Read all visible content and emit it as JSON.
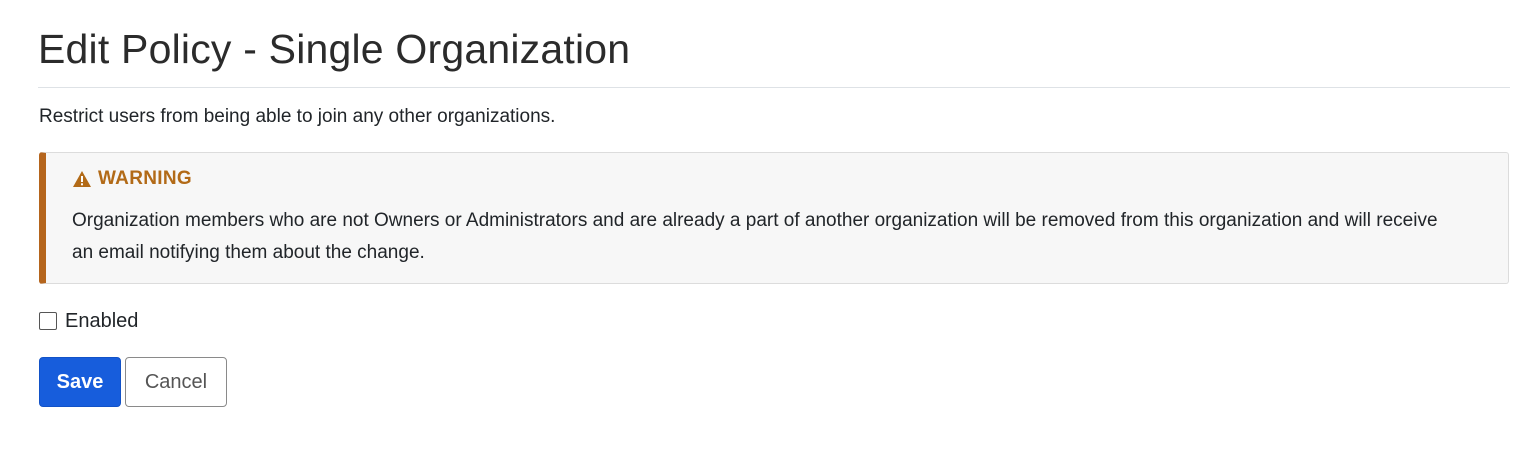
{
  "page": {
    "title": "Edit Policy - Single Organization",
    "description": "Restrict users from being able to join any other organizations."
  },
  "warning": {
    "icon": "warning-triangle-icon",
    "title": "WARNING",
    "body": "Organization members who are not Owners or Administrators and are already a part of another organization will be removed from this organization and will receive an email notifying them about the change.",
    "accent_color": "#b26a17"
  },
  "form": {
    "enabled_label": "Enabled",
    "enabled_checked": false
  },
  "actions": {
    "save_label": "Save",
    "cancel_label": "Cancel",
    "primary_color": "#175ddc"
  }
}
